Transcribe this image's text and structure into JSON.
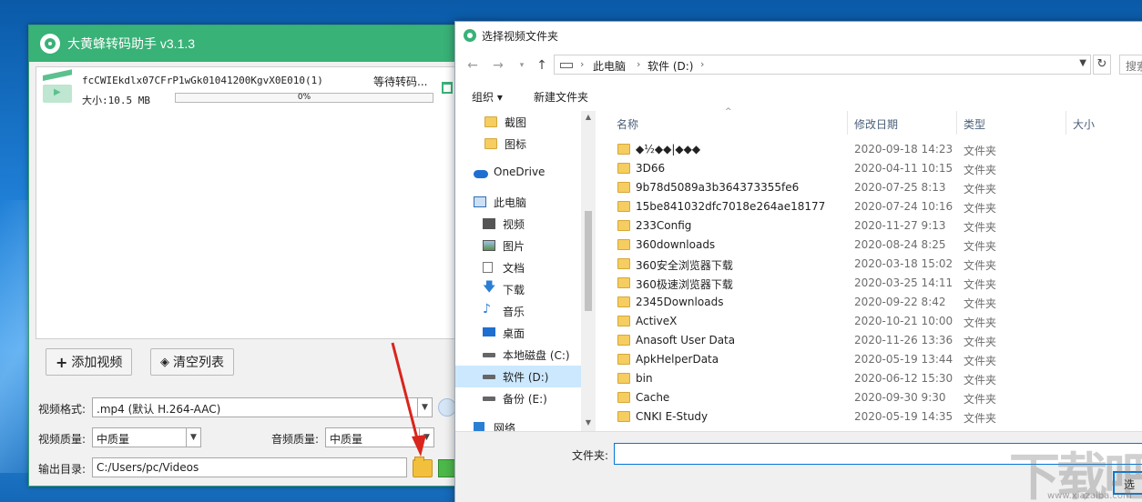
{
  "app": {
    "title": "大黄蜂转码助手 v3.1.3",
    "file": {
      "name": "fcCWIEkdlx07CFrP1wGk01041200KgvX0E010(1)",
      "size": "大小:10.5 MB",
      "progress_text": "0%",
      "progress": 0,
      "status": "等待转码..."
    },
    "buttons": {
      "add_video": "添加视频",
      "clear_list": "清空列表"
    },
    "labels": {
      "video_format": "视频格式:",
      "video_quality": "视频质量:",
      "audio_quality": "音频质量:",
      "output_dir": "输出目录:"
    },
    "values": {
      "video_format": ".mp4 (默认 H.264-AAC)",
      "video_quality": "中质量",
      "audio_quality": "中质量",
      "output_dir": "C:/Users/pc/Videos"
    }
  },
  "dialog": {
    "title": "选择视频文件夹",
    "address": [
      "此电脑",
      "软件 (D:)"
    ],
    "search_placeholder": "搜索",
    "toolbar": {
      "organize": "组织 ▾",
      "new_folder": "新建文件夹"
    },
    "nav": [
      {
        "label": "截图",
        "icon": "folder"
      },
      {
        "label": "图标",
        "icon": "folder"
      },
      {
        "label": "OneDrive",
        "icon": "cloud"
      },
      {
        "label": "此电脑",
        "icon": "pc"
      },
      {
        "label": "视频",
        "icon": "video"
      },
      {
        "label": "图片",
        "icon": "pic"
      },
      {
        "label": "文档",
        "icon": "doc"
      },
      {
        "label": "下载",
        "icon": "down"
      },
      {
        "label": "音乐",
        "icon": "music"
      },
      {
        "label": "桌面",
        "icon": "desktop"
      },
      {
        "label": "本地磁盘 (C:)",
        "icon": "drive"
      },
      {
        "label": "软件 (D:)",
        "icon": "drive",
        "selected": true
      },
      {
        "label": "备份 (E:)",
        "icon": "drive"
      },
      {
        "label": "网络",
        "icon": "net"
      }
    ],
    "columns": {
      "name": "名称",
      "modified": "修改日期",
      "type": "类型",
      "size": "大小"
    },
    "files": [
      {
        "name": "◆½◆◆|◆◆◆",
        "date": "2020-09-18 14:23",
        "type": "文件夹"
      },
      {
        "name": "3D66",
        "date": "2020-04-11 10:15",
        "type": "文件夹"
      },
      {
        "name": "9b78d5089a3b364373355fe6",
        "date": "2020-07-25 8:13",
        "type": "文件夹"
      },
      {
        "name": "15be841032dfc7018e264ae18177",
        "date": "2020-07-24 10:16",
        "type": "文件夹"
      },
      {
        "name": "233Config",
        "date": "2020-11-27 9:13",
        "type": "文件夹"
      },
      {
        "name": "360downloads",
        "date": "2020-08-24 8:25",
        "type": "文件夹"
      },
      {
        "name": "360安全浏览器下载",
        "date": "2020-03-18 15:02",
        "type": "文件夹"
      },
      {
        "name": "360极速浏览器下载",
        "date": "2020-03-25 14:11",
        "type": "文件夹"
      },
      {
        "name": "2345Downloads",
        "date": "2020-09-22 8:42",
        "type": "文件夹"
      },
      {
        "name": "ActiveX",
        "date": "2020-10-21 10:00",
        "type": "文件夹"
      },
      {
        "name": "Anasoft User Data",
        "date": "2020-11-26 13:36",
        "type": "文件夹"
      },
      {
        "name": "ApkHelperData",
        "date": "2020-05-19 13:44",
        "type": "文件夹"
      },
      {
        "name": "bin",
        "date": "2020-06-12 15:30",
        "type": "文件夹"
      },
      {
        "name": "Cache",
        "date": "2020-09-30 9:30",
        "type": "文件夹"
      },
      {
        "name": "CNKI E-Study",
        "date": "2020-05-19 14:35",
        "type": "文件夹"
      }
    ],
    "footer": {
      "folder_label": "文件夹:",
      "folder_value": "",
      "select_button": "选"
    }
  },
  "watermark": {
    "text": "下载吧",
    "url": "www.xiazaiba.com"
  },
  "colors": {
    "brand_green": "#38b277",
    "accent_blue": "#0078d7",
    "arrow_red": "#d9251d"
  }
}
